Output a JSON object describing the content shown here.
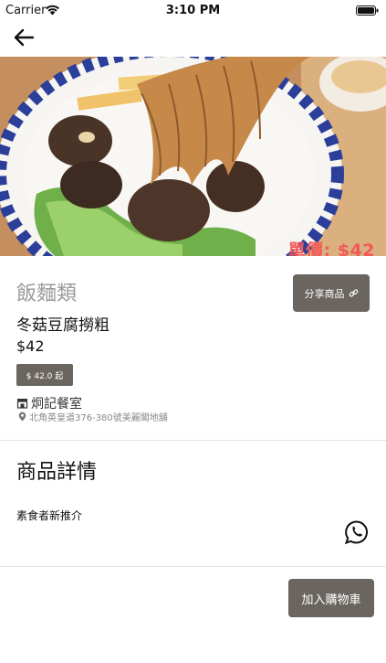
{
  "status_bar": {
    "carrier": "Carrier",
    "time": "3:10 PM"
  },
  "navigation": {
    "back_icon": "arrow-left-icon"
  },
  "hero": {
    "price_overlay": "單價: $42",
    "page_indicator_count": 1,
    "price_overlay_color": "#f25a5a"
  },
  "product": {
    "category": "飯麵類",
    "name": "冬菇豆腐撈粗",
    "price": "$42",
    "min_price_badge": "$ 42.0 起",
    "share_label": "分享商品",
    "share_icon": "link-icon"
  },
  "shop": {
    "icon": "shop-icon",
    "name": "炯記餐室",
    "address_icon": "pin-icon",
    "address": "北角英皇道376-380號美麗閣地舖"
  },
  "details": {
    "title": "商品詳情",
    "description": "素食者新推介",
    "contact_icon": "whatsapp-icon"
  },
  "actions": {
    "add_to_cart": "加入購物車"
  },
  "colors": {
    "button_bg": "#6b6560",
    "category_text": "#9a9a9a"
  }
}
